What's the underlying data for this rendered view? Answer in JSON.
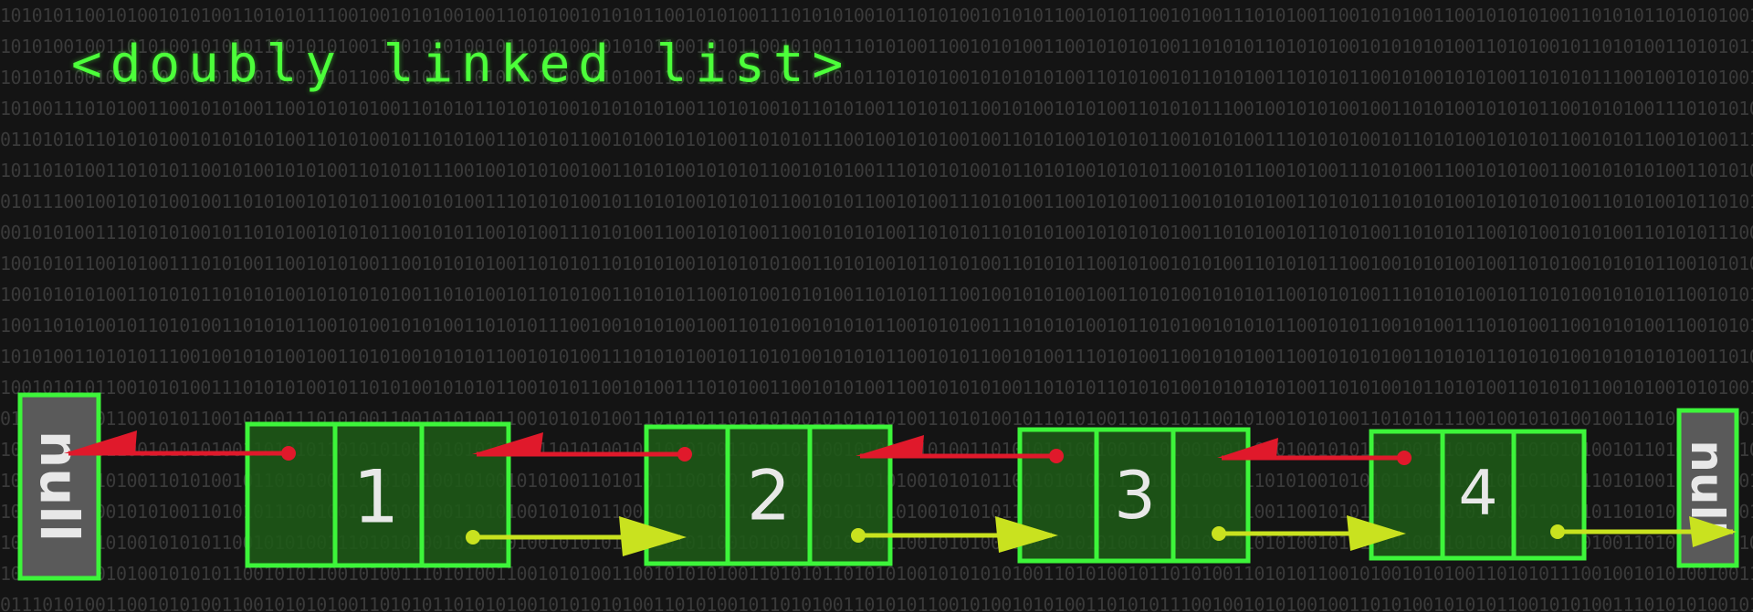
{
  "title": "<doubly linked list>",
  "background_text": "1010101100101001010100110101011100100101010010011010100101010110010101001110101010010110101001010101100101011001010011101010011001010100110010101010011010101101010100101010101001101010010110101001",
  "null_left": {
    "label": "null"
  },
  "null_right": {
    "label": "null"
  },
  "nodes": [
    {
      "value": "1"
    },
    {
      "value": "2"
    },
    {
      "value": "3"
    },
    {
      "value": "4"
    }
  ],
  "colors": {
    "background": "#141414",
    "node_fill": "#1e5a17",
    "node_border": "#3df53a",
    "null_fill": "#5a5a5a",
    "prev_arrow": "#e0192b",
    "next_arrow": "#c9e21f",
    "title": "#4cff3a",
    "value_text": "#e8e8e8"
  }
}
